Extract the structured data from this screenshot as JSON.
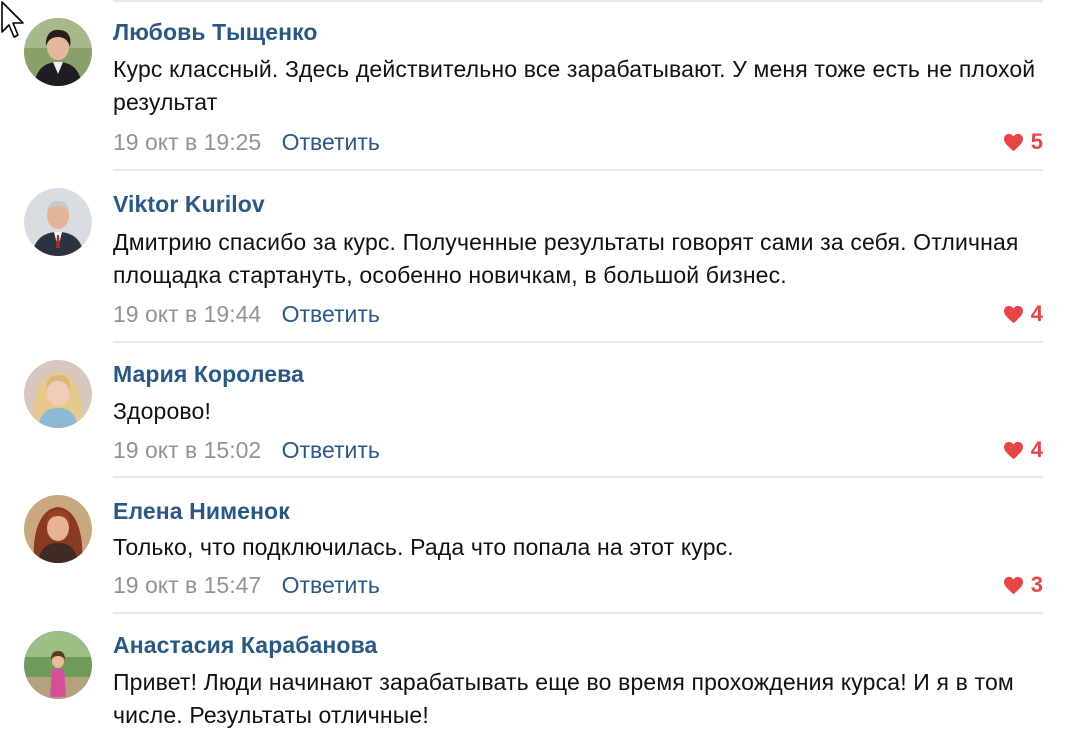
{
  "comments": [
    {
      "author": "Любовь Тыщенко",
      "text": "Курс классный. Здесь действительно все зарабатывают. У меня тоже есть не плохой результат",
      "date": "19 окт в 19:25",
      "reply_label": "Ответить",
      "likes": "5"
    },
    {
      "author": "Viktor Kurilov",
      "text": "Дмитрию спасибо за курс. Полученные результаты говорят сами за себя. Отличная площадка стартануть, особенно новичкам, в большой бизнес.",
      "date": "19 окт в 19:44",
      "reply_label": "Ответить",
      "likes": "4"
    },
    {
      "author": "Мария Королева",
      "text": "Здорово!",
      "date": "19 окт в 15:02",
      "reply_label": "Ответить",
      "likes": "4"
    },
    {
      "author": "Елена Нименок",
      "text": "Только, что подключилась. Рада что попала на этот курс.",
      "date": "19 окт в 15:47",
      "reply_label": "Ответить",
      "likes": "3"
    },
    {
      "author": "Анастасия Карабанова",
      "text": "Привет! Люди начинают зарабатывать еще во время прохождения курса! И я в том числе. Результаты отличные!",
      "date": "",
      "reply_label": "",
      "likes": ""
    }
  ],
  "icons": {
    "like": "heart-icon",
    "cursor": "mouse-pointer-icon"
  },
  "colors": {
    "author": "#2a5885",
    "reply": "#2a5885",
    "date": "#939393",
    "likes": "#e64646",
    "divider": "#e7e8ec"
  }
}
